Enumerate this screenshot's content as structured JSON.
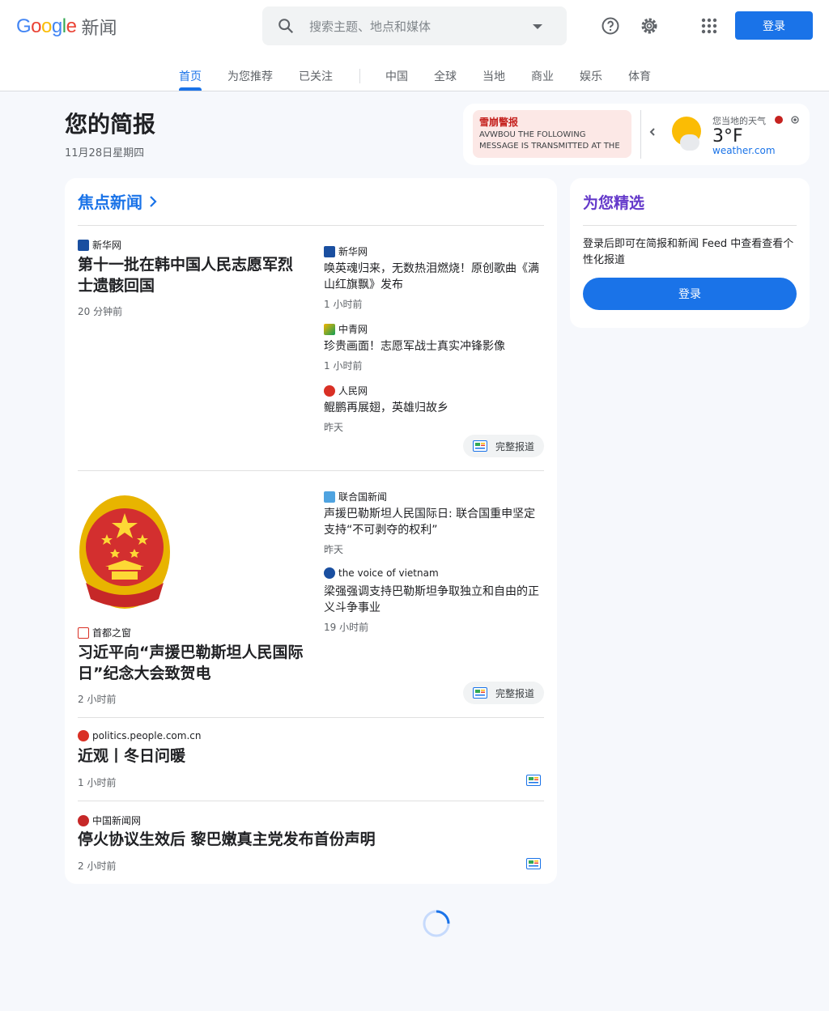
{
  "header": {
    "logo_brand": "Google",
    "logo_product": "新闻",
    "search_placeholder": "搜索主题、地点和媒体",
    "login_label": "登录"
  },
  "tabs": [
    {
      "label": "首页",
      "active": true
    },
    {
      "label": "为您推荐"
    },
    {
      "label": "已关注"
    },
    {
      "label": "中国"
    },
    {
      "label": "全球"
    },
    {
      "label": "当地"
    },
    {
      "label": "商业"
    },
    {
      "label": "娱乐"
    },
    {
      "label": "体育"
    }
  ],
  "briefing": {
    "title": "您的简报",
    "date": "11月28日星期四"
  },
  "weather": {
    "alert_title": "雪崩警报",
    "alert_body": "AVWBOU THE FOLLOWING MESSAGE IS TRANSMITTED AT THE REQUEST O...",
    "label": "您当地的天气",
    "temp": "3°F",
    "source": "weather.com"
  },
  "top_stories": {
    "title": "焦点新闻",
    "full_coverage": "完整报道",
    "clusters": [
      {
        "main": {
          "source": "新华网",
          "headline": "第十一批在韩中国人民志愿军烈士遗骸回国",
          "time": "20 分钟前"
        },
        "related": [
          {
            "source": "新华网",
            "headline": "唤英魂归来，无数热泪燃烧！原创歌曲《满山红旗飘》发布",
            "time": "1 小时前"
          },
          {
            "source": "中青网",
            "headline": "珍贵画面！志愿军战士真实冲锋影像",
            "time": "1 小时前"
          },
          {
            "source": "人民网",
            "headline": "鲲鹏再展翅，英雄归故乡",
            "time": "昨天"
          }
        ]
      },
      {
        "main": {
          "source": "首都之窗",
          "headline": "习近平向“声援巴勒斯坦人民国际日”纪念大会致贺电",
          "time": "2 小时前"
        },
        "related": [
          {
            "source": "联合国新闻",
            "headline": "声援巴勒斯坦人民国际日: 联合国重申坚定支持“不可剥夺的权利”",
            "time": "昨天"
          },
          {
            "source": "the voice of vietnam",
            "headline": "梁强强调支持巴勒斯坦争取独立和自由的正义斗争事业",
            "time": "19 小时前"
          }
        ]
      }
    ],
    "singles": [
      {
        "source": "politics.people.com.cn",
        "headline": "近观丨冬日问暖",
        "time": "1 小时前"
      },
      {
        "source": "中国新闻网",
        "headline": "停火协议生效后 黎巴嫩真主党发布首份声明",
        "time": "2 小时前"
      }
    ]
  },
  "picks": {
    "title": "为您精选",
    "desc": "登录后即可在简报和新闻 Feed 中查看查看个性化报道",
    "button": "登录"
  },
  "colors": {
    "accent": "#1a73e8",
    "picks": "#6439ca",
    "alert": "#c5221f"
  }
}
